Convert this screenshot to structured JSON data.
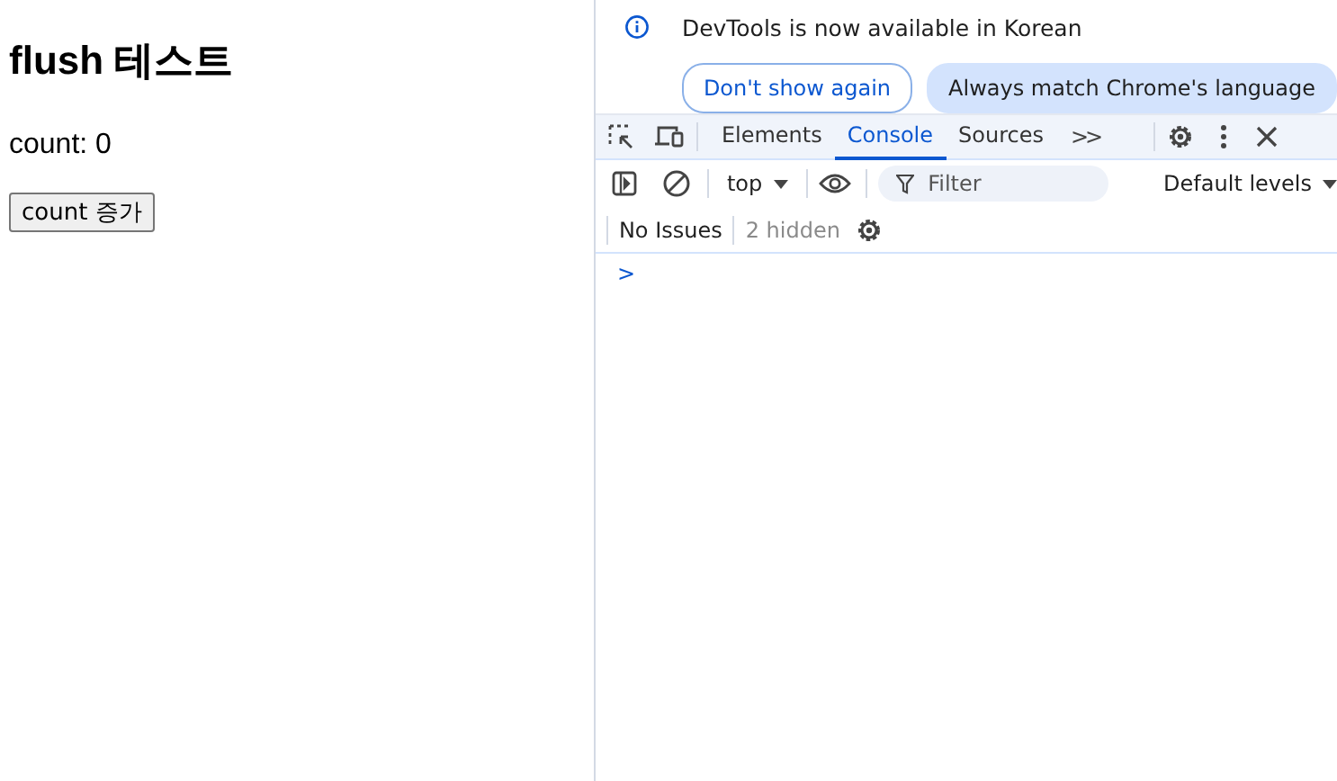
{
  "page": {
    "heading": "flush 테스트",
    "count_text": "count: 0",
    "button": "count 증가"
  },
  "devtools": {
    "infobar": {
      "message": "DevTools is now available in Korean",
      "buttons": [
        {
          "label": "Don't show again",
          "kind": "outline"
        },
        {
          "label": "Always match Chrome's language",
          "kind": "filled"
        }
      ]
    },
    "tabs": [
      {
        "label": "Elements",
        "selected": false
      },
      {
        "label": "Console",
        "selected": true
      },
      {
        "label": "Sources",
        "selected": false
      }
    ],
    "more_tabs": ">>",
    "context": "top",
    "filter": {
      "placeholder": "Filter"
    },
    "levels": "Default levels",
    "issues": "No Issues",
    "hidden": "2 hidden",
    "prompt": ">"
  }
}
